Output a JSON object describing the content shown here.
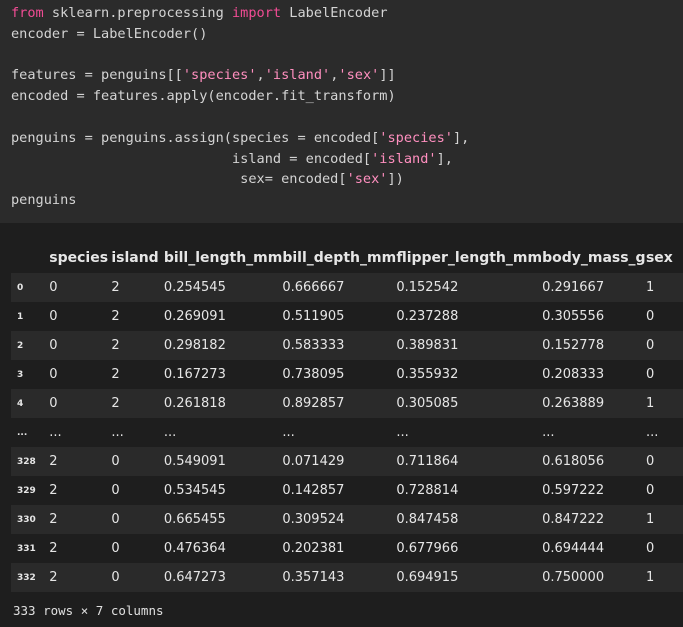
{
  "code_cell": {
    "lines": [
      [
        {
          "t": "from",
          "c": "kw"
        },
        {
          "t": " sklearn.preprocessing "
        },
        {
          "t": "import",
          "c": "kw"
        },
        {
          "t": " LabelEncoder"
        }
      ],
      [
        {
          "t": "encoder = LabelEncoder()"
        }
      ],
      [],
      [
        {
          "t": "features = penguins[["
        },
        {
          "t": "'species'",
          "c": "str"
        },
        {
          "t": ","
        },
        {
          "t": "'island'",
          "c": "str"
        },
        {
          "t": ","
        },
        {
          "t": "'sex'",
          "c": "str"
        },
        {
          "t": "]]"
        }
      ],
      [
        {
          "t": "encoded = features.apply(encoder.fit_transform)"
        }
      ],
      [],
      [
        {
          "t": "penguins = penguins.assign(species = encoded["
        },
        {
          "t": "'species'",
          "c": "str"
        },
        {
          "t": "],"
        }
      ],
      [
        {
          "t": "                           island = encoded["
        },
        {
          "t": "'island'",
          "c": "str"
        },
        {
          "t": "],"
        }
      ],
      [
        {
          "t": "                            sex= encoded["
        },
        {
          "t": "'sex'",
          "c": "str"
        },
        {
          "t": "])"
        }
      ],
      [
        {
          "t": "penguins"
        }
      ]
    ]
  },
  "table": {
    "columns": [
      "",
      "species",
      "island",
      "bill_length_mm",
      "bill_depth_mm",
      "flipper_length_mm",
      "body_mass_g",
      "sex"
    ],
    "rows": [
      [
        "0",
        "0",
        "2",
        "0.254545",
        "0.666667",
        "0.152542",
        "0.291667",
        "1"
      ],
      [
        "1",
        "0",
        "2",
        "0.269091",
        "0.511905",
        "0.237288",
        "0.305556",
        "0"
      ],
      [
        "2",
        "0",
        "2",
        "0.298182",
        "0.583333",
        "0.389831",
        "0.152778",
        "0"
      ],
      [
        "3",
        "0",
        "2",
        "0.167273",
        "0.738095",
        "0.355932",
        "0.208333",
        "0"
      ],
      [
        "4",
        "0",
        "2",
        "0.261818",
        "0.892857",
        "0.305085",
        "0.263889",
        "1"
      ],
      [
        "...",
        "...",
        "...",
        "...",
        "...",
        "...",
        "...",
        "..."
      ],
      [
        "328",
        "2",
        "0",
        "0.549091",
        "0.071429",
        "0.711864",
        "0.618056",
        "0"
      ],
      [
        "329",
        "2",
        "0",
        "0.534545",
        "0.142857",
        "0.728814",
        "0.597222",
        "0"
      ],
      [
        "330",
        "2",
        "0",
        "0.665455",
        "0.309524",
        "0.847458",
        "0.847222",
        "1"
      ],
      [
        "331",
        "2",
        "0",
        "0.476364",
        "0.202381",
        "0.677966",
        "0.694444",
        "0"
      ],
      [
        "332",
        "2",
        "0",
        "0.647273",
        "0.357143",
        "0.694915",
        "0.750000",
        "1"
      ]
    ]
  },
  "footer": "333 rows × 7 columns",
  "colors": {
    "keyword": "#f14c94",
    "string": "#ff8fbf",
    "code_background": "#2b2b2b",
    "output_background": "#1e1e1e"
  }
}
